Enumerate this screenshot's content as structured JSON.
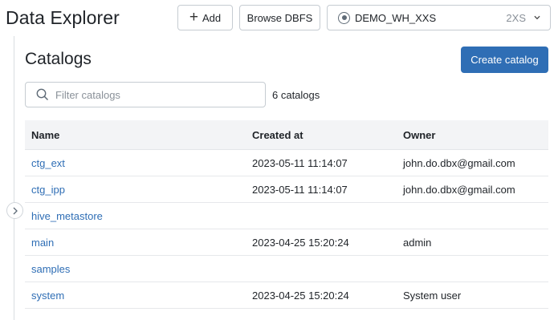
{
  "header": {
    "title": "Data Explorer",
    "add_label": "Add",
    "browse_label": "Browse DBFS",
    "warehouse": {
      "name": "DEMO_WH_XXS",
      "size": "2XS"
    }
  },
  "main": {
    "title": "Catalogs",
    "create_label": "Create catalog",
    "filter_placeholder": "Filter catalogs",
    "count_label": "6 catalogs"
  },
  "table": {
    "columns": [
      "Name",
      "Created at",
      "Owner"
    ],
    "rows": [
      {
        "name": "ctg_ext",
        "created": "2023-05-11 11:14:07",
        "owner": "john.do.dbx@gmail.com"
      },
      {
        "name": "ctg_ipp",
        "created": "2023-05-11 11:14:07",
        "owner": "john.do.dbx@gmail.com"
      },
      {
        "name": "hive_metastore",
        "created": "",
        "owner": ""
      },
      {
        "name": "main",
        "created": "2023-04-25 15:20:24",
        "owner": "admin"
      },
      {
        "name": "samples",
        "created": "",
        "owner": ""
      },
      {
        "name": "system",
        "created": "2023-04-25 15:20:24",
        "owner": "System user"
      }
    ]
  },
  "icons": {
    "add": "plus-icon",
    "warehouse": "warehouse-status-icon",
    "dropdown": "chevron-down-icon",
    "search": "search-icon",
    "toggle": "chevron-right-icon"
  },
  "colors": {
    "primary": "#2f6eb5",
    "link": "#2f6eb5",
    "header_bg": "#f3f4f6"
  }
}
